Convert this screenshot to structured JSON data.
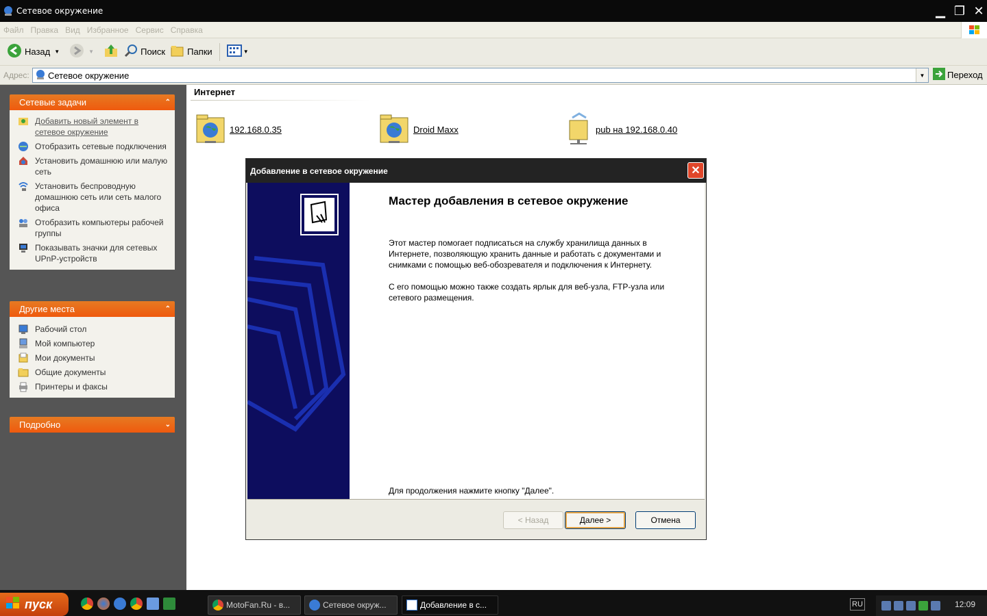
{
  "window": {
    "title": "Сетевое окружение"
  },
  "menubar": {
    "items": [
      "Файл",
      "Правка",
      "Вид",
      "Избранное",
      "Сервис",
      "Справка"
    ]
  },
  "toolbar": {
    "back_label": "Назад",
    "search_label": "Поиск",
    "folders_label": "Папки"
  },
  "addressbar": {
    "label": "Адрес:",
    "value": "Сетевое окружение",
    "go_label": "Переход"
  },
  "sidebar": {
    "network_tasks": {
      "title": "Сетевые задачи",
      "items": [
        {
          "label": "Добавить новый элемент в сетевое окружение",
          "icon": "add-network-place-icon"
        },
        {
          "label": "Отобразить сетевые подключения",
          "icon": "network-connections-icon"
        },
        {
          "label": "Установить домашнюю или малую сеть",
          "icon": "home-network-icon"
        },
        {
          "label": "Установить беспроводную домашнюю сеть или сеть малого офиса",
          "icon": "wireless-network-icon"
        },
        {
          "label": "Отобразить компьютеры рабочей группы",
          "icon": "workgroup-icon"
        },
        {
          "label": "Показывать значки для сетевых UPnP-устройств",
          "icon": "upnp-icon"
        }
      ]
    },
    "other_places": {
      "title": "Другие места",
      "items": [
        {
          "label": "Рабочий стол",
          "icon": "desktop-icon"
        },
        {
          "label": "Мой компьютер",
          "icon": "my-computer-icon"
        },
        {
          "label": "Мои документы",
          "icon": "my-documents-icon"
        },
        {
          "label": "Общие документы",
          "icon": "shared-documents-icon"
        },
        {
          "label": "Принтеры и факсы",
          "icon": "printers-icon"
        }
      ]
    },
    "details": {
      "title": "Подробно"
    }
  },
  "content": {
    "group_title": "Интернет",
    "items": [
      {
        "label": "192.168.0.35",
        "icon": "web-folder-icon"
      },
      {
        "label": "Droid Maxx",
        "icon": "web-folder-icon"
      },
      {
        "label": "pub на 192.168.0.40",
        "icon": "network-share-icon"
      }
    ]
  },
  "dialog": {
    "title": "Добавление в сетевое окружение",
    "heading": "Мастер добавления в сетевое окружение",
    "para1": "Этот мастер помогает подписаться на службу хранилища данных в Интернете, позволяющую хранить данные и работать с документами и снимками с помощью веб-обозревателя и подключения к Интернету.",
    "para2": "С его помощью можно также создать ярлык для веб-узла, FTP-узла или сетевого размещения.",
    "footer_text": "Для продолжения нажмите кнопку \"Далее\".",
    "back_label": "< Назад",
    "next_label": "Далее >",
    "cancel_label": "Отмена"
  },
  "taskbar": {
    "start_label": "пуск",
    "tasks": [
      {
        "label": "MotoFan.Ru - в...",
        "active": false
      },
      {
        "label": "Сетевое окруж...",
        "active": false
      },
      {
        "label": "Добавление в с...",
        "active": true
      }
    ],
    "lang": "RU",
    "clock": "12:09"
  }
}
